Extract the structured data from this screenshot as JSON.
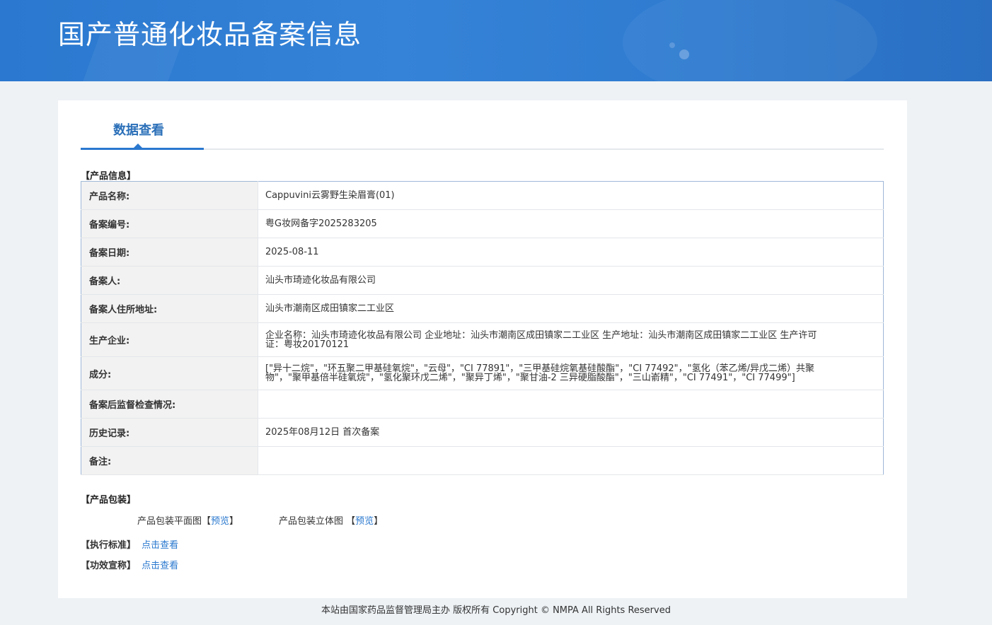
{
  "header": {
    "title": "国产普通化妆品备案信息"
  },
  "tabs": [
    {
      "label": "数据查看",
      "active": true
    }
  ],
  "product_info": {
    "section_title": "【产品信息】",
    "rows": [
      {
        "key": "产品名称:",
        "value": "Cappuvini云雾野生染眉膏(01)"
      },
      {
        "key": "备案编号:",
        "value": "粤G妆网备字2025283205"
      },
      {
        "key": "备案日期:",
        "value": "2025-08-11"
      },
      {
        "key": "备案人:",
        "value": "汕头市琦迹化妆品有限公司"
      },
      {
        "key": "备案人住所地址:",
        "value": "汕头市潮南区成田镇家二工业区"
      },
      {
        "key": "生产企业:",
        "value": "企业名称：汕头市琦迹化妆品有限公司 企业地址：汕头市潮南区成田镇家二工业区 生产地址：汕头市潮南区成田镇家二工业区 生产许可证：粤妆20170121"
      },
      {
        "key": "成分:",
        "value": "[\"异十二烷\"，\"环五聚二甲基硅氧烷\"，\"云母\"，\"CI 77891\"，\"三甲基硅烷氧基硅酸酯\"，\"CI 77492\"，\"氢化（苯乙烯/异戊二烯）共聚物\"，\"聚甲基倍半硅氧烷\"，\"氢化聚环戊二烯\"，\"聚异丁烯\"，\"聚甘油-2 三异硬脂酸酯\"，\"三山嵛精\"，\"CI 77491\"，\"CI 77499\"]"
      },
      {
        "key": "备案后监督检查情况:",
        "value": ""
      },
      {
        "key": "历史记录:",
        "value": "2025年08月12日 首次备案"
      },
      {
        "key": "备注:",
        "value": ""
      }
    ]
  },
  "packaging": {
    "section_title": "【产品包装】",
    "flat_label": "产品包装平面图",
    "solid_label": "产品包装立体图",
    "bracket_open": "【",
    "bracket_close": "】",
    "preview_link": "预览"
  },
  "standard": {
    "label": "【执行标准】",
    "link": "点击查看"
  },
  "efficacy": {
    "label": "【功效宣称】",
    "link": "点击查看"
  },
  "footer": {
    "text": "本站由国家药品监督管理局主办 版权所有 Copyright © NMPA All Rights Reserved"
  }
}
